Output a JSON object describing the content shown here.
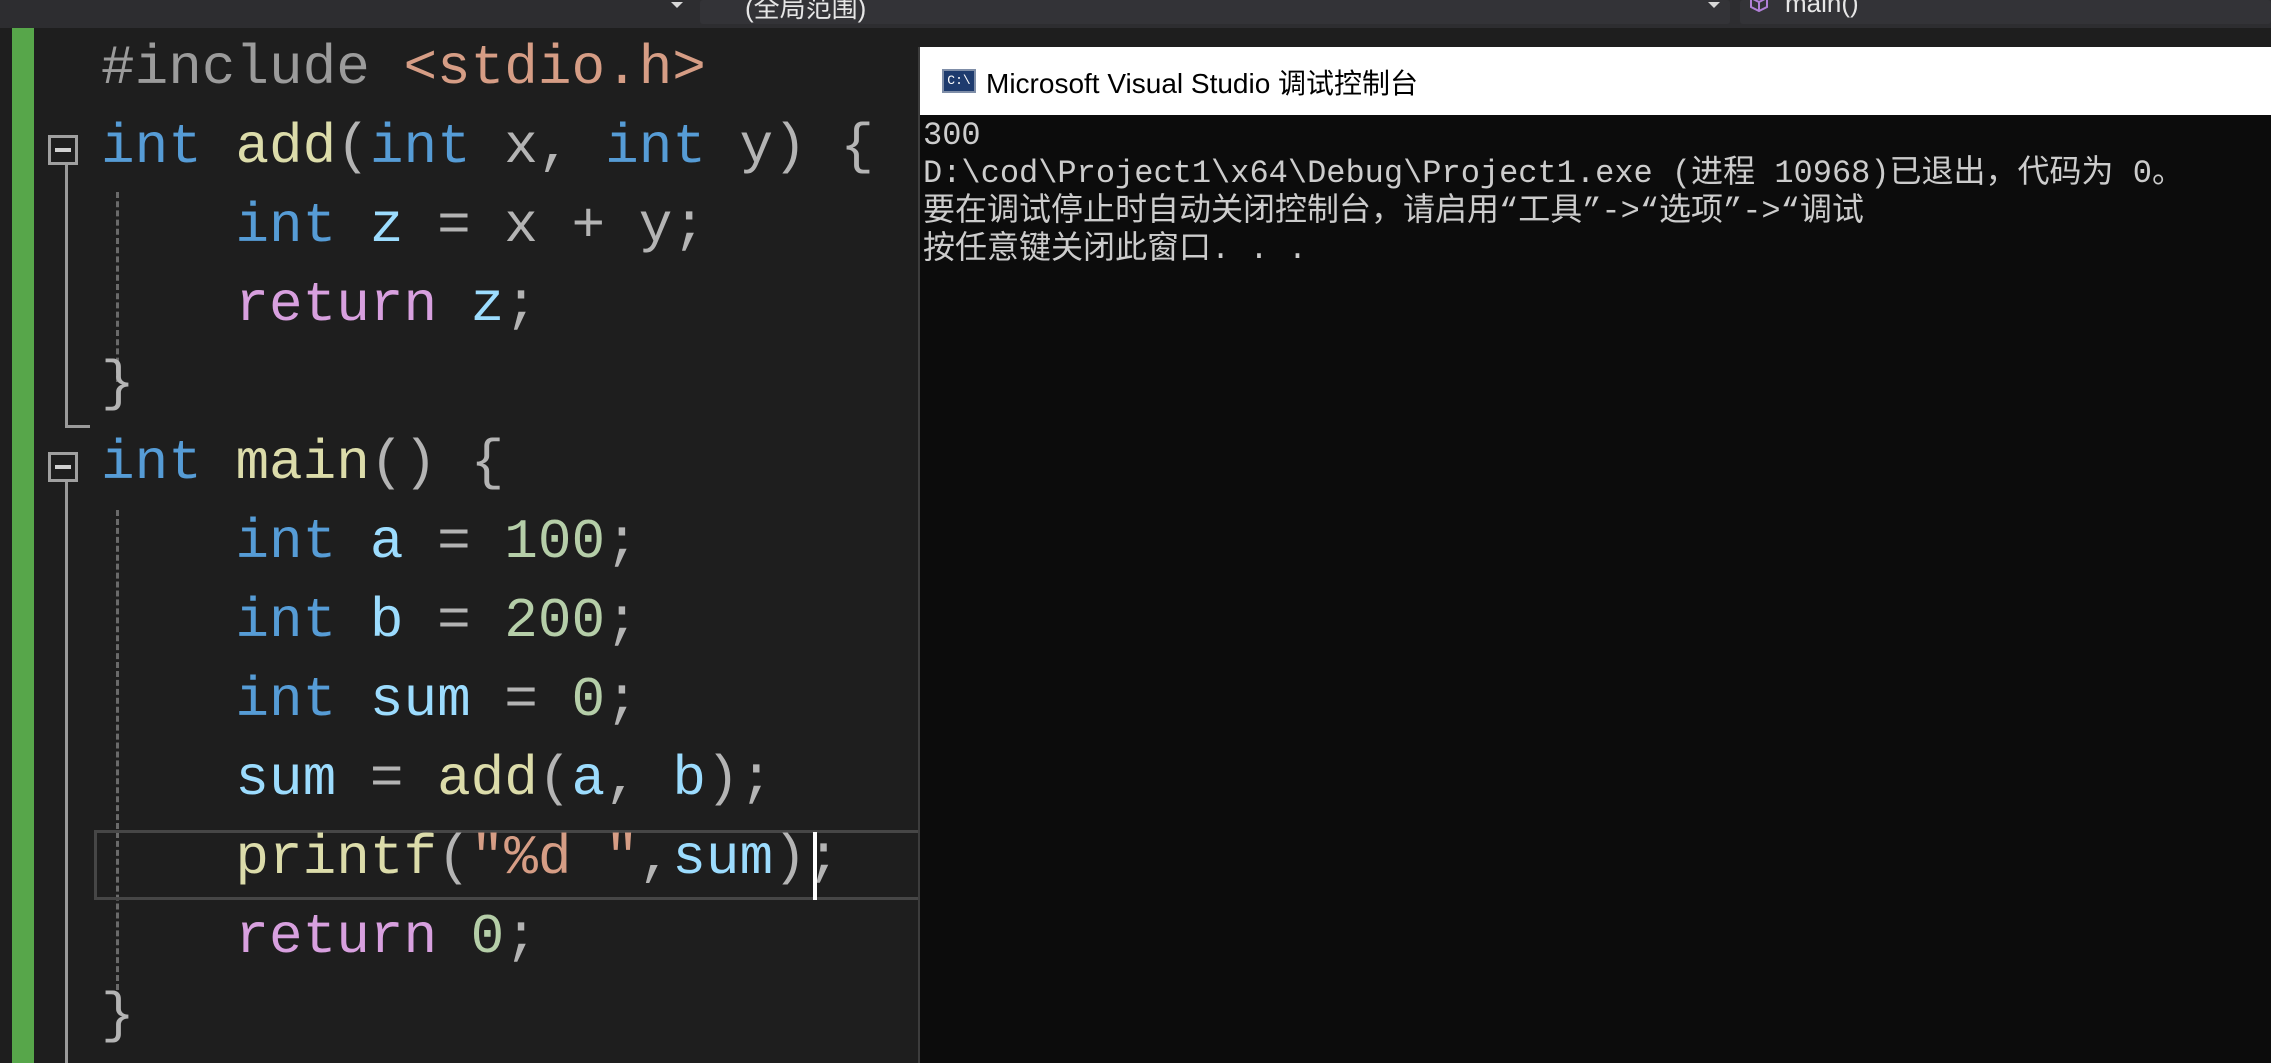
{
  "navbar": {
    "scope": "(全局范围)",
    "member": "main()",
    "member_icon": "cube-icon",
    "arrow_icon": "chevron-down-icon"
  },
  "editor": {
    "lines": [
      [
        {
          "t": "#include ",
          "c": "pre"
        },
        {
          "t": "<stdio.h>",
          "c": "inc"
        }
      ],
      [
        {
          "t": "int",
          "c": "kw"
        },
        {
          "t": " ",
          "c": "pun"
        },
        {
          "t": "add",
          "c": "fn"
        },
        {
          "t": "(",
          "c": "pun"
        },
        {
          "t": "int",
          "c": "kw"
        },
        {
          "t": " x, ",
          "c": "pun"
        },
        {
          "t": "int",
          "c": "kw"
        },
        {
          "t": " y) {",
          "c": "pun"
        }
      ],
      [
        {
          "t": "    ",
          "c": "pun"
        },
        {
          "t": "int",
          "c": "kw"
        },
        {
          "t": " ",
          "c": "pun"
        },
        {
          "t": "z",
          "c": "var"
        },
        {
          "t": " = x + y;",
          "c": "pun"
        }
      ],
      [
        {
          "t": "    ",
          "c": "pun"
        },
        {
          "t": "return",
          "c": "ctl"
        },
        {
          "t": " ",
          "c": "pun"
        },
        {
          "t": "z",
          "c": "var"
        },
        {
          "t": ";",
          "c": "pun"
        }
      ],
      [
        {
          "t": "}",
          "c": "pun"
        }
      ],
      [
        {
          "t": "int",
          "c": "kw"
        },
        {
          "t": " ",
          "c": "pun"
        },
        {
          "t": "main",
          "c": "fn"
        },
        {
          "t": "() {",
          "c": "pun"
        }
      ],
      [
        {
          "t": "    ",
          "c": "pun"
        },
        {
          "t": "int",
          "c": "kw"
        },
        {
          "t": " ",
          "c": "pun"
        },
        {
          "t": "a",
          "c": "var"
        },
        {
          "t": " = ",
          "c": "pun"
        },
        {
          "t": "100",
          "c": "num"
        },
        {
          "t": ";",
          "c": "pun"
        }
      ],
      [
        {
          "t": "    ",
          "c": "pun"
        },
        {
          "t": "int",
          "c": "kw"
        },
        {
          "t": " ",
          "c": "pun"
        },
        {
          "t": "b",
          "c": "var"
        },
        {
          "t": " = ",
          "c": "pun"
        },
        {
          "t": "200",
          "c": "num"
        },
        {
          "t": ";",
          "c": "pun"
        }
      ],
      [
        {
          "t": "    ",
          "c": "pun"
        },
        {
          "t": "int",
          "c": "kw"
        },
        {
          "t": " ",
          "c": "pun"
        },
        {
          "t": "sum",
          "c": "var"
        },
        {
          "t": " = ",
          "c": "pun"
        },
        {
          "t": "0",
          "c": "num"
        },
        {
          "t": ";",
          "c": "pun"
        }
      ],
      [
        {
          "t": "    ",
          "c": "pun"
        },
        {
          "t": "sum",
          "c": "var"
        },
        {
          "t": " = ",
          "c": "pun"
        },
        {
          "t": "add",
          "c": "fn"
        },
        {
          "t": "(",
          "c": "pun"
        },
        {
          "t": "a",
          "c": "var"
        },
        {
          "t": ", ",
          "c": "pun"
        },
        {
          "t": "b",
          "c": "var"
        },
        {
          "t": ");",
          "c": "pun"
        }
      ],
      [
        {
          "t": "    ",
          "c": "pun"
        },
        {
          "t": "printf",
          "c": "fn"
        },
        {
          "t": "(",
          "c": "pun"
        },
        {
          "t": "\"%d \"",
          "c": "str"
        },
        {
          "t": ",",
          "c": "pun"
        },
        {
          "t": "sum",
          "c": "var"
        },
        {
          "t": ");",
          "c": "pun"
        }
      ],
      [
        {
          "t": "    ",
          "c": "pun"
        },
        {
          "t": "return",
          "c": "ctl"
        },
        {
          "t": " ",
          "c": "pun"
        },
        {
          "t": "0",
          "c": "num"
        },
        {
          "t": ";",
          "c": "pun"
        }
      ],
      [
        {
          "t": "}",
          "c": "pun"
        }
      ]
    ]
  },
  "console": {
    "title": "Microsoft Visual Studio 调试控制台",
    "icon_label": "C:\\",
    "lines": [
      "300",
      "D:\\cod\\Project1\\x64\\Debug\\Project1.exe (进程 10968)已退出，代码为 0。",
      "要在调试停止时自动关闭控制台，请启用“工具”->“选项”->“调试",
      "按任意键关闭此窗口. . ."
    ]
  }
}
